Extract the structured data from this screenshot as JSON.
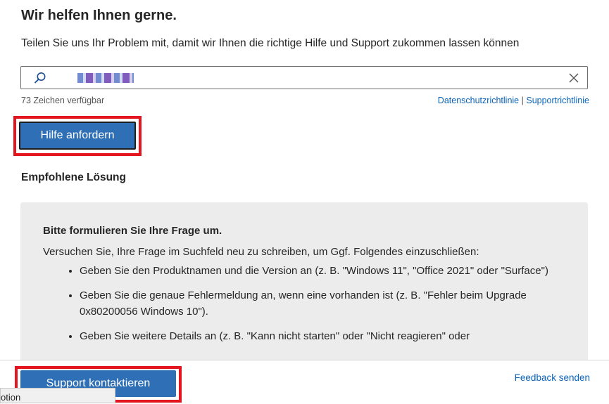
{
  "header": {
    "title": "Wir helfen Ihnen gerne.",
    "subtitle": "Teilen Sie uns Ihr Problem mit, damit wir Ihnen die richtige Hilfe und Support zukommen lassen können"
  },
  "search": {
    "value": "▪▪▪▪▪▪▪",
    "icon": "search-icon",
    "clear_icon": "close-icon",
    "char_count": "73 Zeichen verfügbar"
  },
  "links": {
    "privacy": "Datenschutzrichtlinie",
    "separator": "|",
    "support": "Supportrichtlinie"
  },
  "actions": {
    "request_help": "Hilfe anfordern",
    "contact_support": "Support kontaktieren",
    "feedback": "Feedback senden"
  },
  "recommended": {
    "heading": "Empfohlene Lösung",
    "title": "Bitte formulieren Sie Ihre Frage um.",
    "intro": "Versuchen Sie, Ihre Frage im Suchfeld neu zu schreiben, um Ggf. Folgendes einzuschließen:",
    "items": [
      "Geben Sie den Produktnamen und die Version an (z. B. \"Windows 11\", \"Office 2021\" oder \"Surface\")",
      "Geben Sie die genaue Fehlermeldung an, wenn eine vorhanden ist (z. B. \"Fehler beim Upgrade 0x80200056 Windows 10\").",
      "Geben Sie weitere Details an (z. B. \"Kann nicht starten\" oder \"Nicht reagieren\" oder"
    ]
  },
  "tooltip": {
    "text": "otion"
  },
  "colors": {
    "primary_button": "#2f6fb6",
    "highlight": "#e3151f",
    "link": "#0a62b8",
    "panel": "#ececec"
  }
}
